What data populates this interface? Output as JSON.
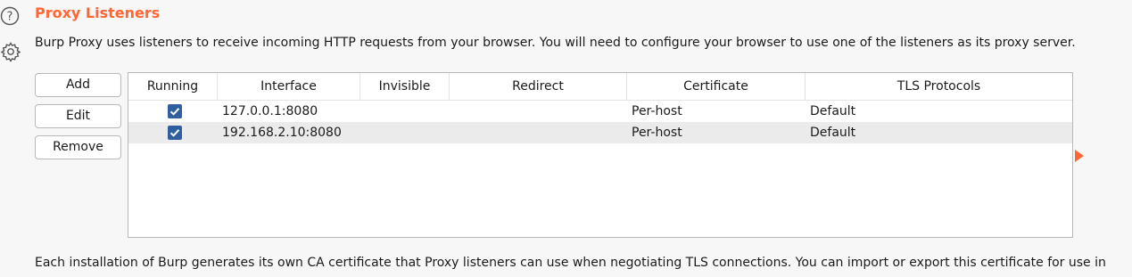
{
  "section": {
    "title": "Proxy Listeners",
    "description": "Burp Proxy uses listeners to receive incoming HTTP requests from your browser. You will need to configure your browser to use one of the listeners as its proxy server.",
    "footer": "Each installation of Burp generates its own CA certificate that Proxy listeners can use when negotiating TLS connections. You can import or export this certificate for use in"
  },
  "buttons": {
    "add": "Add",
    "edit": "Edit",
    "remove": "Remove"
  },
  "table": {
    "columns": [
      "Running",
      "Interface",
      "Invisible",
      "Redirect",
      "Certificate",
      "TLS Protocols"
    ],
    "rows": [
      {
        "running": true,
        "interface": "127.0.0.1:8080",
        "invisible": "",
        "redirect": "",
        "certificate": "Per-host",
        "tls": "Default"
      },
      {
        "running": true,
        "interface": "192.168.2.10:8080",
        "invisible": "",
        "redirect": "",
        "certificate": "Per-host",
        "tls": "Default"
      }
    ]
  },
  "icons": {
    "help": "help-icon",
    "settings": "gear-icon",
    "expand": "triangle-right-icon"
  },
  "colors": {
    "accent": "#ff6633",
    "checkbox": "#2f5f9e"
  }
}
